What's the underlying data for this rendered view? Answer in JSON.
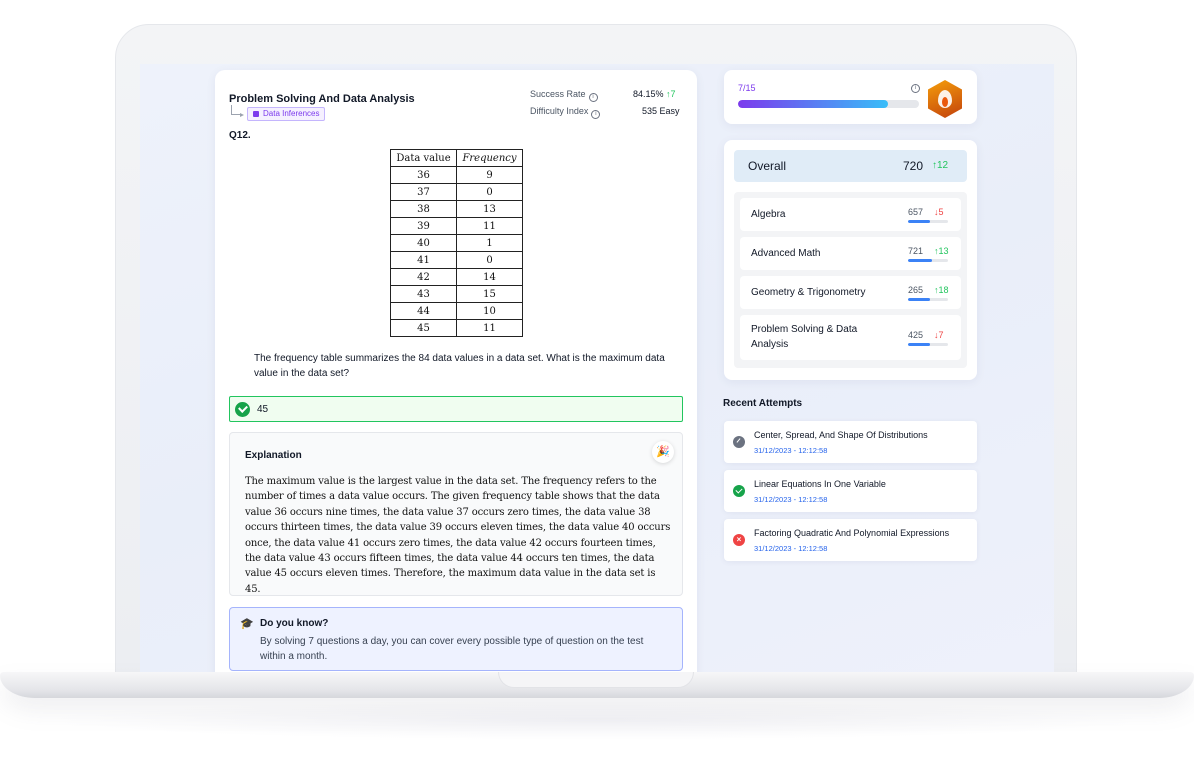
{
  "question_card": {
    "topic_title": "Problem Solving And Data Analysis",
    "tag": "Data Inferences",
    "success_rate_label": "Success Rate",
    "success_rate_value": "84.15%",
    "success_rate_delta": "↑7",
    "difficulty_label": "Difficulty Index",
    "difficulty_value": "535 Easy",
    "question_number": "Q12.",
    "table": {
      "headers": [
        "Data value",
        "Frequency"
      ],
      "rows": [
        [
          "36",
          "9"
        ],
        [
          "37",
          "0"
        ],
        [
          "38",
          "13"
        ],
        [
          "39",
          "11"
        ],
        [
          "40",
          "1"
        ],
        [
          "41",
          "0"
        ],
        [
          "42",
          "14"
        ],
        [
          "43",
          "15"
        ],
        [
          "44",
          "10"
        ],
        [
          "45",
          "11"
        ]
      ]
    },
    "question_text": "The frequency table summarizes the 84 data values in a data set. What is the maximum data value in the data set?",
    "answer": "45",
    "explanation_title": "Explanation",
    "explanation_text": "The maximum value is the largest value in the data set. The frequency refers to the number of times a data value occurs. The given frequency table shows that the data value 36 occurs nine times, the data value 37 occurs zero times, the data value 38 occurs thirteen times, the data value 39 occurs eleven times, the data value 40 occurs once, the data value 41 occurs zero times, the data value 42 occurs fourteen times, the data value 43 occurs fifteen times, the data value 44 occurs ten times, the data value 45 occurs eleven times. Therefore, the maximum data value in the data set is 45.",
    "tip_title": "Do you know?",
    "tip_text": "By solving 7 questions a day, you can cover every possible type of question on the test within a month."
  },
  "progress": {
    "label": "7/15",
    "fraction": 0.83
  },
  "scores": {
    "overall_label": "Overall",
    "overall_value": "720",
    "overall_delta": "↑12",
    "subjects": [
      {
        "name": "Algebra",
        "score": "657",
        "delta": "↓5",
        "direction": "down",
        "bar": 0.55
      },
      {
        "name": "Advanced Math",
        "score": "721",
        "delta": "↑13",
        "direction": "up",
        "bar": 0.6
      },
      {
        "name": "Geometry & Trigonometry",
        "score": "265",
        "delta": "↑18",
        "direction": "up",
        "bar": 0.55
      },
      {
        "name": "Problem Solving & Data Analysis",
        "score": "425",
        "delta": "↓7",
        "direction": "down",
        "bar": 0.55
      }
    ]
  },
  "recent": {
    "title": "Recent Attempts",
    "attempts": [
      {
        "name": "Center, Spread, And Shape Of Distributions",
        "date": "31/12/2023 - 12:12:58",
        "status": "timer-icon"
      },
      {
        "name": "Linear Equations In One Variable",
        "date": "31/12/2023 - 12:12:58",
        "status": "check-icon"
      },
      {
        "name": "Factoring Quadratic And Polynomial Expressions",
        "date": "31/12/2023 - 12:12:58",
        "status": "cross-icon"
      }
    ]
  },
  "colors": {
    "accent_purple": "#7c3aed",
    "success_green": "#16a34a",
    "error_red": "#ef4444",
    "link_blue": "#2563eb"
  }
}
